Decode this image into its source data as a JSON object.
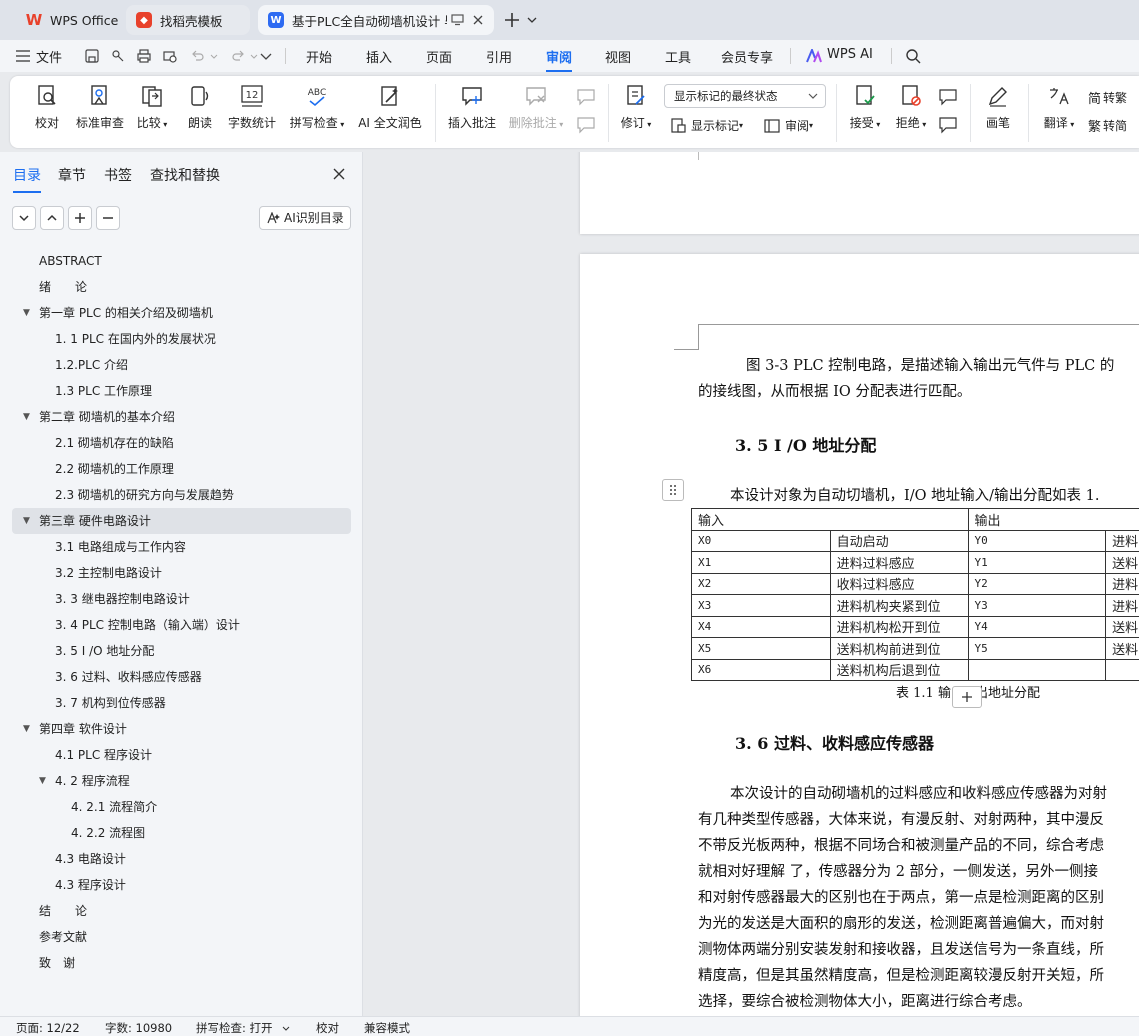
{
  "tabs": [
    {
      "label": "WPS Office"
    },
    {
      "label": "找稻壳模板"
    },
    {
      "label": "基于PLC全自动砌墙机设计 毕"
    }
  ],
  "menu": {
    "file": "文件",
    "items": [
      "开始",
      "插入",
      "页面",
      "引用",
      "审阅",
      "视图",
      "工具",
      "会员专享"
    ],
    "active_index": 4,
    "wps_ai": "WPS AI"
  },
  "ribbon": {
    "proofread": "校对",
    "standard_review": "标准审查",
    "compare": "比较",
    "read_aloud": "朗读",
    "word_count": "字数统计",
    "spell_check": "拼写检查",
    "ai_polish": "AI 全文润色",
    "insert_comment": "插入批注",
    "delete_comment": "删除批注",
    "track_changes": "修订",
    "markup_dropdown": "显示标记的最终状态",
    "show_markup": "显示标记",
    "review": "审阅",
    "accept": "接受",
    "reject": "拒绝",
    "pen": "画笔",
    "translate": "翻译",
    "to_traditional": "转繁",
    "to_simplified": "转简",
    "word_count_icon_text": "12",
    "spell_icon_text": "ABC"
  },
  "sidebar": {
    "tabs": [
      "目录",
      "章节",
      "书签",
      "查找和替换"
    ],
    "active_tab": 0,
    "ai_button": "AI识别目录",
    "toc": [
      {
        "label": "ABSTRACT",
        "level": 0,
        "caret": ""
      },
      {
        "label": "绪　　论",
        "level": 0,
        "caret": ""
      },
      {
        "label": "第一章  PLC 的相关介绍及砌墙机",
        "level": 0,
        "caret": "▼"
      },
      {
        "label": "1. 1 PLC 在国内外的发展状况",
        "level": 1,
        "caret": ""
      },
      {
        "label": "1.2.PLC 介绍",
        "level": 1,
        "caret": ""
      },
      {
        "label": "1.3 PLC 工作原理",
        "level": 1,
        "caret": ""
      },
      {
        "label": "第二章  砌墙机的基本介绍",
        "level": 0,
        "caret": "▼"
      },
      {
        "label": "2.1 砌墙机存在的缺陷",
        "level": 1,
        "caret": ""
      },
      {
        "label": "2.2 砌墙机的工作原理",
        "level": 1,
        "caret": ""
      },
      {
        "label": "2.3  砌墙机的研究方向与发展趋势",
        "level": 1,
        "caret": ""
      },
      {
        "label": "第三章  硬件电路设计",
        "level": 0,
        "caret": "▼",
        "selected": true
      },
      {
        "label": "3.1 电路组成与工作内容",
        "level": 1,
        "caret": ""
      },
      {
        "label": "3.2 主控制电路设计",
        "level": 1,
        "caret": ""
      },
      {
        "label": "3. 3  继电器控制电路设计",
        "level": 1,
        "caret": ""
      },
      {
        "label": "3. 4 PLC 控制电路（输入端）设计",
        "level": 1,
        "caret": ""
      },
      {
        "label": "3. 5 I /O  地址分配",
        "level": 1,
        "caret": ""
      },
      {
        "label": "3. 6  过料、收料感应传感器",
        "level": 1,
        "caret": ""
      },
      {
        "label": "3. 7  机构到位传感器",
        "level": 1,
        "caret": ""
      },
      {
        "label": "第四章  软件设计",
        "level": 0,
        "caret": "▼"
      },
      {
        "label": "4.1 PLC 程序设计",
        "level": 1,
        "caret": ""
      },
      {
        "label": "4. 2 程序流程",
        "level": 1,
        "caret": "▼"
      },
      {
        "label": "4. 2.1 流程简介",
        "level": 2,
        "caret": ""
      },
      {
        "label": "4. 2.2 流程图",
        "level": 2,
        "caret": ""
      },
      {
        "label": "4.3 电路设计",
        "level": 1,
        "caret": ""
      },
      {
        "label": "4.3 程序设计",
        "level": 1,
        "caret": ""
      },
      {
        "label": "结　　论",
        "level": 0,
        "caret": ""
      },
      {
        "label": "参考文献",
        "level": 0,
        "caret": ""
      },
      {
        "label": "致　谢",
        "level": 0,
        "caret": ""
      }
    ]
  },
  "document": {
    "para1_line1": "图 3-3 PLC 控制电路，是描述输入输出元气件与 PLC 的",
    "para1_line2": "的接线图，从而根据 IO 分配表进行匹配。",
    "heading_35": "3. 5 I /O  地址分配",
    "para2": "本设计对象为自动切墙机，I/O  地址输入/输出分配如表  1.",
    "table": {
      "header_input": "输入",
      "header_output": "输出",
      "rows": [
        {
          "in_code": "X0",
          "in_desc": "自动启动",
          "out_code": "Y0",
          "out_desc": "进料"
        },
        {
          "in_code": "X1",
          "in_desc": "进料过料感应",
          "out_code": "Y1",
          "out_desc": "送料"
        },
        {
          "in_code": "X2",
          "in_desc": "收料过料感应",
          "out_code": "Y2",
          "out_desc": "进料"
        },
        {
          "in_code": "X3",
          "in_desc": "进料机构夹紧到位",
          "out_code": "Y3",
          "out_desc": "进料"
        },
        {
          "in_code": "X4",
          "in_desc": "进料机构松开到位",
          "out_code": "Y4",
          "out_desc": "送料"
        },
        {
          "in_code": "X5",
          "in_desc": "送料机构前进到位",
          "out_code": "Y5",
          "out_desc": "送料"
        },
        {
          "in_code": "X6",
          "in_desc": "送料机构后退到位",
          "out_code": "",
          "out_desc": ""
        }
      ],
      "caption_left": "表 1.1 输",
      "caption_right": "出地址分配"
    },
    "heading_36": "3. 6  过料、收料感应传感器",
    "para3": [
      "本次设计的自动砌墙机的过料感应和收料感应传感器为对射",
      "有几种类型传感器，大体来说，有漫反射、对射两种，其中漫反",
      "不带反光板两种，根据不同场合和被测量产品的不同，综合考虑",
      "就相对好理解 了，传感器分为 2 部分，一侧发送，另外一侧接",
      "和对射传感器最大的区别也在于两点，第一点是检测距离的区别",
      "为光的发送是大面积的扇形的发送，检测距离普遍偏大，而对射",
      "测物体两端分别安装发射和接收器，且发送信号为一条直线，所",
      "精度高，但是其虽然精度高，但是检测距离较漫反射开关短，所",
      "选择，要综合被检测物体大小，距离进行综合考虑。"
    ]
  },
  "status": {
    "page": "页面: 12/22",
    "words": "字数: 10980",
    "spell": "拼写检查: 打开",
    "proof": "校对",
    "compat": "兼容模式"
  },
  "colors": {
    "accent": "#1d6ef0",
    "wps_red": "#e8412b",
    "docer_red": "#e8412b",
    "writer_blue": "#2e6bf2"
  }
}
